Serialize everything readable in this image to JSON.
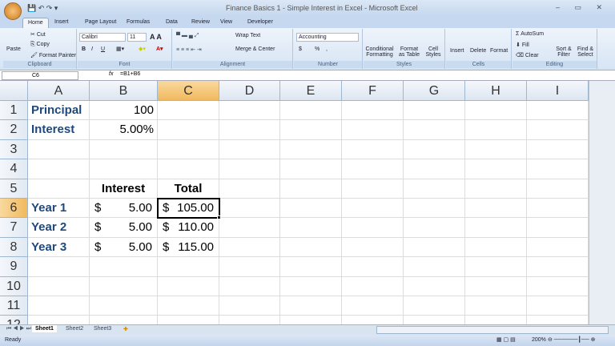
{
  "window": {
    "title": "Finance Basics 1 - Simple Interest in Excel - Microsoft Excel",
    "controls": "– ▭ ✕"
  },
  "tabs": [
    "Home",
    "Insert",
    "Page Layout",
    "Formulas",
    "Data",
    "Review",
    "View",
    "Developer"
  ],
  "ribbon": {
    "clipboard": {
      "paste": "Paste",
      "cut": "Cut",
      "copy": "Copy",
      "format_painter": "Format Painter",
      "label": "Clipboard"
    },
    "font": {
      "name": "Calibri",
      "size": "11",
      "label": "Font",
      "bold": "B",
      "italic": "I",
      "underline": "U"
    },
    "alignment": {
      "wrap": "Wrap Text",
      "merge": "Merge & Center",
      "label": "Alignment"
    },
    "number": {
      "format": "Accounting",
      "currency": "$",
      "percent": "%",
      "comma": ",",
      "label": "Number"
    },
    "styles": {
      "conditional": "Conditional Formatting",
      "table": "Format as Table",
      "cell": "Cell Styles",
      "label": "Styles"
    },
    "cells": {
      "insert": "Insert",
      "delete": "Delete",
      "format": "Format",
      "label": "Cells"
    },
    "editing": {
      "autosum": "AutoSum",
      "fill": "Fill",
      "clear": "Clear",
      "sort": "Sort & Filter",
      "find": "Find & Select",
      "label": "Editing"
    }
  },
  "formula_bar": {
    "name_box": "C6",
    "fx": "fx",
    "formula": "=B1+B6"
  },
  "columns": [
    "A",
    "B",
    "C",
    "D",
    "E",
    "F",
    "G",
    "H",
    "I"
  ],
  "rows": [
    "1",
    "2",
    "3",
    "4",
    "5",
    "6",
    "7",
    "8",
    "9",
    "10",
    "11",
    "12"
  ],
  "cells": [
    {
      "ref": "A1",
      "v": "Principal",
      "style": "label"
    },
    {
      "ref": "B1",
      "v": "100",
      "style": "right"
    },
    {
      "ref": "A2",
      "v": "Interest",
      "style": "label"
    },
    {
      "ref": "B2",
      "v": "5.00%",
      "style": "right"
    },
    {
      "ref": "B5",
      "v": "Interest",
      "style": "head"
    },
    {
      "ref": "C5",
      "v": "Total",
      "style": "head"
    },
    {
      "ref": "A6",
      "v": "Year 1",
      "style": "label"
    },
    {
      "ref": "B6",
      "v": "5.00",
      "style": "acct"
    },
    {
      "ref": "C6",
      "v": "105.00",
      "style": "acct"
    },
    {
      "ref": "A7",
      "v": "Year 2",
      "style": "label"
    },
    {
      "ref": "B7",
      "v": "5.00",
      "style": "acct"
    },
    {
      "ref": "C7",
      "v": "110.00",
      "style": "acct"
    },
    {
      "ref": "A8",
      "v": "Year 3",
      "style": "label"
    },
    {
      "ref": "B8",
      "v": "5.00",
      "style": "acct"
    },
    {
      "ref": "C8",
      "v": "115.00",
      "style": "acct"
    }
  ],
  "currency_symbol": "$",
  "selected": "C6",
  "sheets": [
    "Sheet1",
    "Sheet2",
    "Sheet3"
  ],
  "status": {
    "ready": "Ready",
    "zoom": "200%"
  },
  "colors": {
    "label": "#1f497d",
    "selection": "#000000"
  }
}
